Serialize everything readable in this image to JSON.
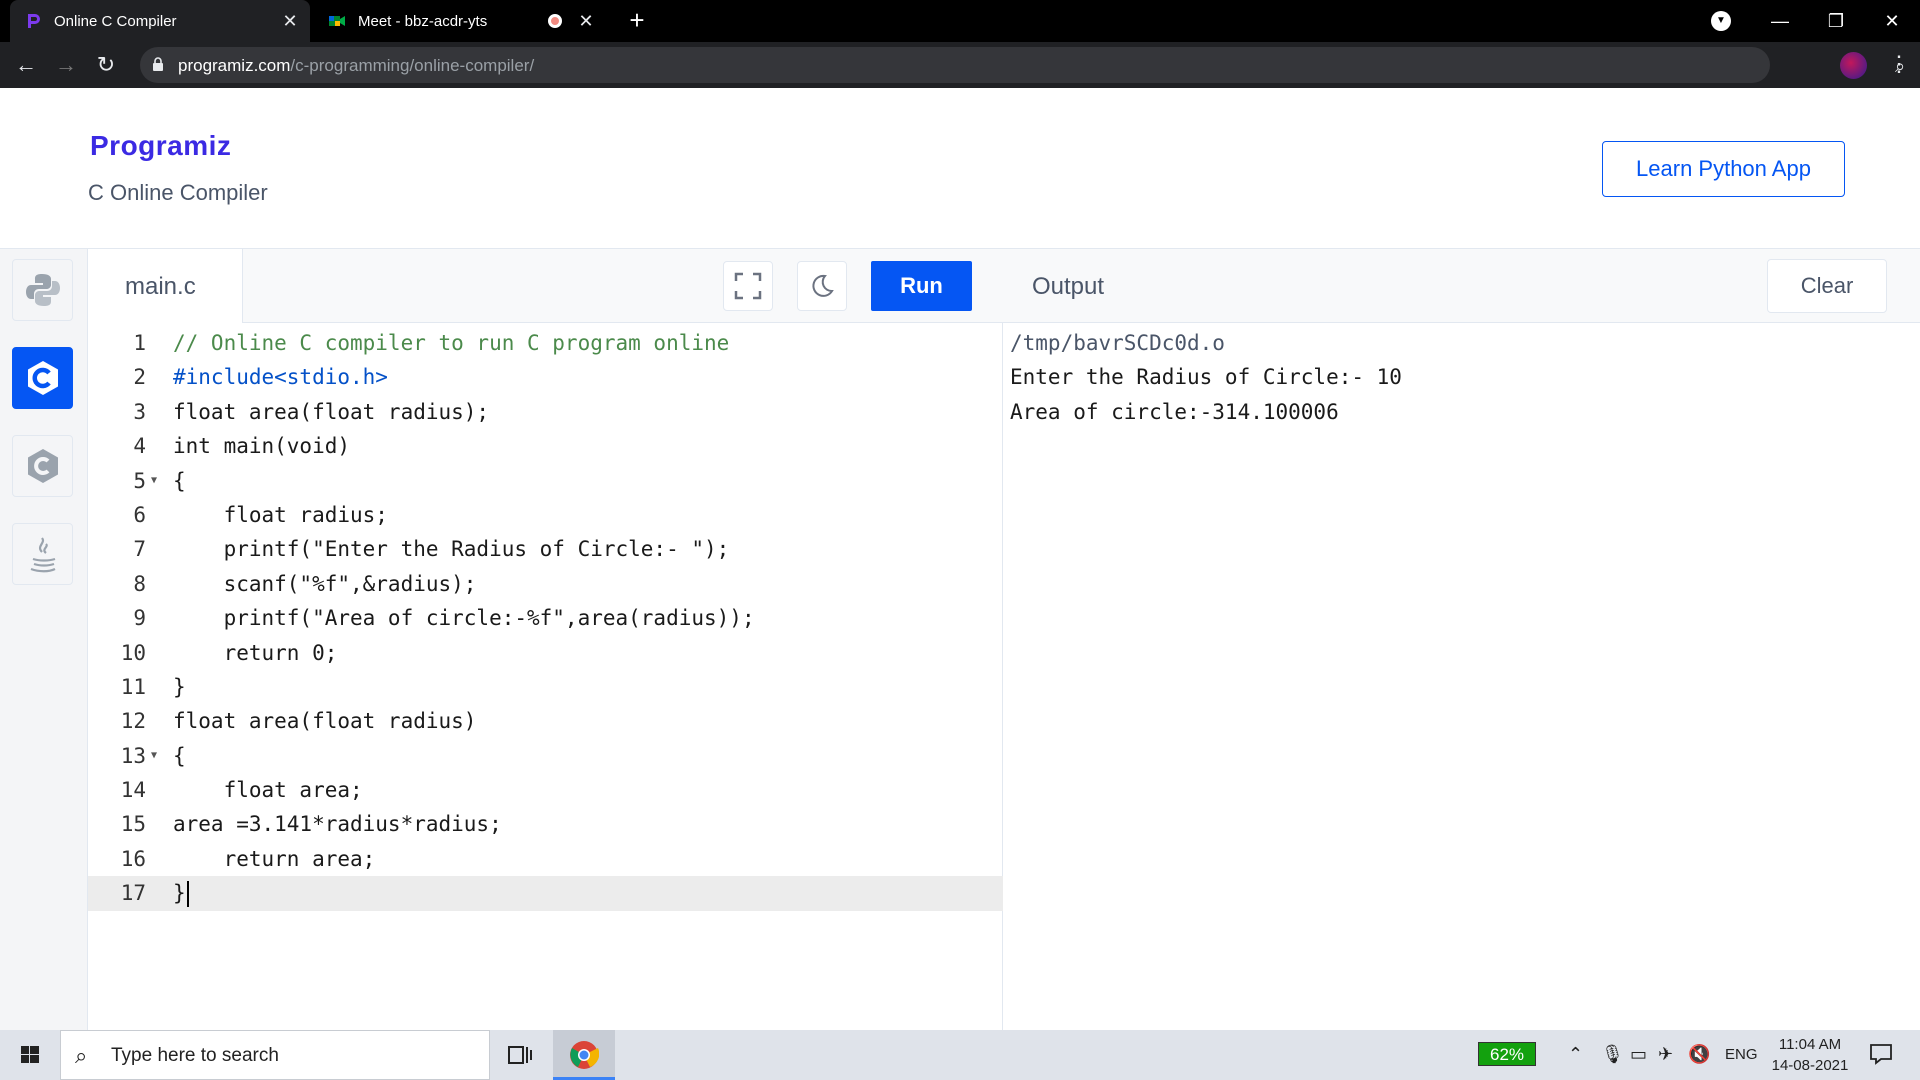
{
  "browser": {
    "tabs": [
      {
        "title": "Online C Compiler",
        "active": true
      },
      {
        "title": "Meet - bbz-acdr-yts",
        "active": false
      }
    ],
    "url_host": "programiz.com",
    "url_path": "/c-programming/online-compiler/"
  },
  "header": {
    "logo": "Programiz",
    "subtitle": "C Online Compiler",
    "cta": "Learn Python App"
  },
  "sidebar": {
    "languages": [
      "python-icon",
      "c-icon",
      "cpp-icon",
      "java-icon"
    ],
    "selected": "c-icon"
  },
  "editor": {
    "file_name": "main.c",
    "run_label": "Run",
    "lines": [
      {
        "num": "1",
        "code": "// Online C compiler to run C program online"
      },
      {
        "num": "2",
        "code": "#include<stdio.h>"
      },
      {
        "num": "3",
        "code": "float area(float radius);"
      },
      {
        "num": "4",
        "code": "int main(void)"
      },
      {
        "num": "5",
        "code": "{"
      },
      {
        "num": "6",
        "code": "    float radius;"
      },
      {
        "num": "7",
        "code": "    printf(\"Enter the Radius of Circle:- \");"
      },
      {
        "num": "8",
        "code": "    scanf(\"%f\",&radius);"
      },
      {
        "num": "9",
        "code": "    printf(\"Area of circle:-%f\",area(radius));"
      },
      {
        "num": "10",
        "code": "    return 0;"
      },
      {
        "num": "11",
        "code": "}"
      },
      {
        "num": "12",
        "code": "float area(float radius)"
      },
      {
        "num": "13",
        "code": "{"
      },
      {
        "num": "14",
        "code": "    float area;"
      },
      {
        "num": "15",
        "code": "area =3.141*radius*radius;"
      },
      {
        "num": "16",
        "code": "    return area;"
      },
      {
        "num": "17",
        "code": "}"
      }
    ]
  },
  "output": {
    "title": "Output",
    "clear_label": "Clear",
    "lines": [
      "/tmp/bavrSCDc0d.o",
      "Enter the Radius of Circle:- 10",
      "Area of circle:-314.100006"
    ]
  },
  "taskbar": {
    "search_placeholder": "Type here to search",
    "battery": "62%",
    "language": "ENG",
    "time": "11:04 AM",
    "date": "14-08-2021"
  },
  "colors": {
    "accent": "#0556f3",
    "brand": "#3b2ae3"
  }
}
